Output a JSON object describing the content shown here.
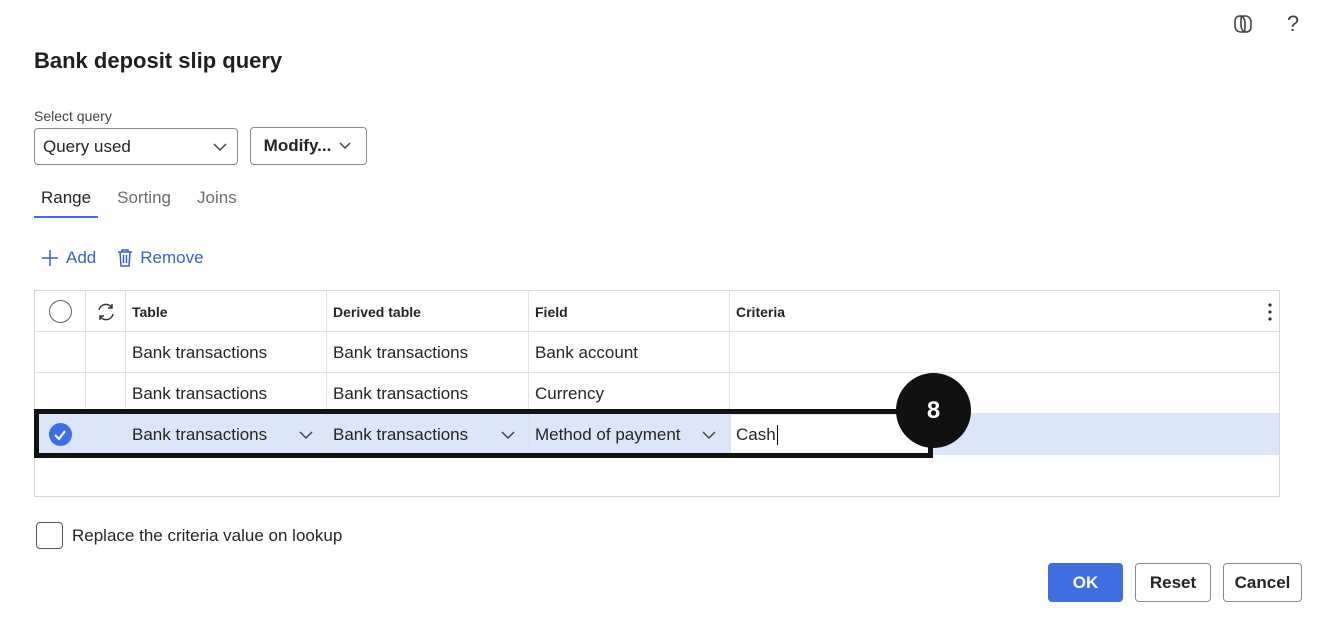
{
  "header": {
    "title": "Bank deposit slip query",
    "icons": [
      "copilot-icon",
      "help-icon"
    ],
    "help_glyph": "?"
  },
  "query": {
    "label": "Select query",
    "selected": "Query used",
    "modify_label": "Modify..."
  },
  "tabs": [
    {
      "label": "Range",
      "active": true
    },
    {
      "label": "Sorting",
      "active": false
    },
    {
      "label": "Joins",
      "active": false
    }
  ],
  "actions": {
    "add_label": "Add",
    "remove_label": "Remove"
  },
  "grid": {
    "columns": [
      "Table",
      "Derived table",
      "Field",
      "Criteria"
    ],
    "rows": [
      {
        "table": "Bank transactions",
        "derived": "Bank transactions",
        "field": "Bank account",
        "criteria": "",
        "selected": false
      },
      {
        "table": "Bank transactions",
        "derived": "Bank transactions",
        "field": "Currency",
        "criteria": "",
        "selected": false
      },
      {
        "table": "Bank transactions",
        "derived": "Bank transactions",
        "field": "Method of payment",
        "criteria": "Cash",
        "selected": true
      }
    ]
  },
  "step_badge": "8",
  "options": {
    "replace_label": "Replace the criteria value on lookup",
    "replace_checked": false
  },
  "footer": {
    "ok_label": "OK",
    "reset_label": "Reset",
    "cancel_label": "Cancel"
  },
  "colors": {
    "accent": "#3f6fe0",
    "link": "#3b5fc8",
    "selected_row": "#dce6fa"
  }
}
